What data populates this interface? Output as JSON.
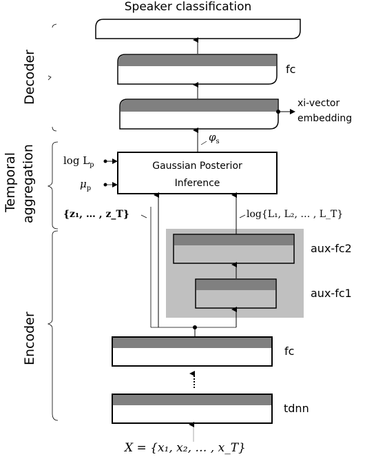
{
  "title": "Speaker classification",
  "sections": {
    "decoder": "Decoder",
    "temporal_aggregation_line1": "Temporal",
    "temporal_aggregation_line2": "aggregation",
    "encoder": "Encoder"
  },
  "blocks": {
    "decoder_fc": "fc",
    "embedding_line1": "xi-vector",
    "embedding_line2": "embedding",
    "gpi_line1": "Gaussian Posterior",
    "gpi_line2": "Inference",
    "aux_fc2": "aux-fc2",
    "aux_fc1": "aux-fc1",
    "encoder_fc": "fc",
    "tdnn": "tdnn"
  },
  "math": {
    "phi_s": "φ",
    "phi_sub": "s",
    "log_Lp": "log L",
    "log_Lp_sub": "p",
    "mu_p": "μ",
    "mu_p_sub": "p",
    "z_set": "{z₁, … , z_T}",
    "log_L_set": "log{L₁, L₂, … , L_T}",
    "input": "X = {x₁, x₂, … , x_T}"
  },
  "colors": {
    "layer_header": "#808080",
    "aux_background": "#c0c0c0",
    "stroke": "#000000"
  }
}
